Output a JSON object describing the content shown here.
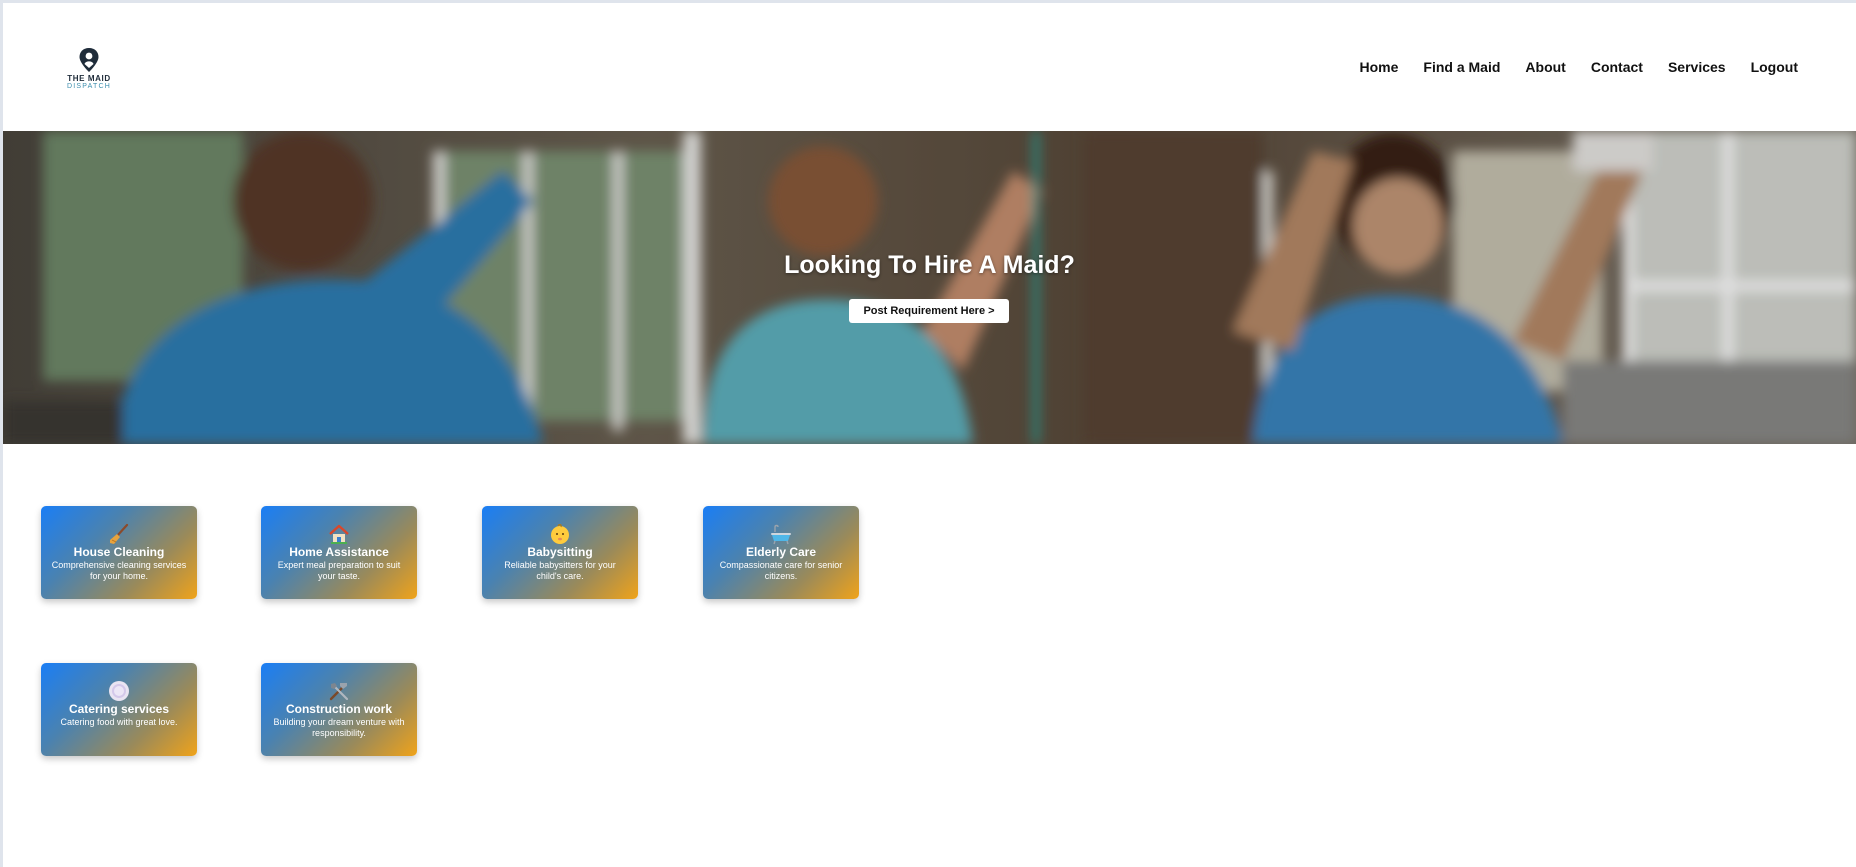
{
  "brand": {
    "name_line1": "THE MAID",
    "name_line2": "DISPATCH",
    "logo_icon": "maid-location-pin-icon",
    "dark_color": "#1f2c3a",
    "accent_color": "#3d8fae"
  },
  "nav": {
    "items": [
      {
        "label": "Home"
      },
      {
        "label": "Find a Maid"
      },
      {
        "label": "About"
      },
      {
        "label": "Contact"
      },
      {
        "label": "Services"
      },
      {
        "label": "Logout"
      }
    ]
  },
  "hero": {
    "title": "Looking To Hire A Maid?",
    "button_label": "Post Requirement Here >"
  },
  "services": [
    {
      "title": "House Cleaning",
      "description": "Comprehensive cleaning services for your home.",
      "icon": "broom-icon"
    },
    {
      "title": "Home Assistance",
      "description": "Expert meal preparation to suit your taste.",
      "icon": "house-icon"
    },
    {
      "title": "Babysitting",
      "description": "Reliable babysitters for your child's care.",
      "icon": "baby-icon"
    },
    {
      "title": "Elderly Care",
      "description": "Compassionate care for senior citizens.",
      "icon": "bathtub-icon"
    },
    {
      "title": "Catering services",
      "description": "Catering food with great love.",
      "icon": "plate-icon"
    },
    {
      "title": "Construction work",
      "description": "Building your dream venture with responsibility.",
      "icon": "tools-icon"
    }
  ],
  "colors": {
    "card_gradient_start": "#1a7ef5",
    "card_gradient_end": "#f0a31a"
  }
}
